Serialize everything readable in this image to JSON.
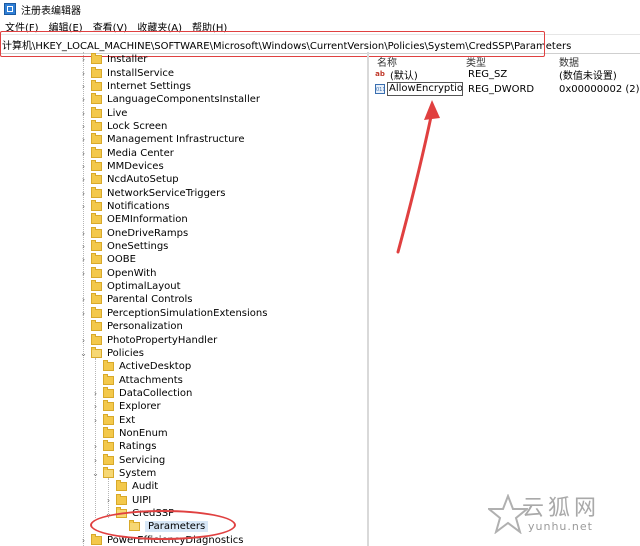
{
  "window": {
    "title": "注册表编辑器"
  },
  "menu": [
    "文件(F)",
    "编辑(E)",
    "查看(V)",
    "收藏夹(A)",
    "帮助(H)"
  ],
  "address": {
    "path": "计算机\\HKEY_LOCAL_MACHINE\\SOFTWARE\\Microsoft\\Windows\\CurrentVersion\\Policies\\System\\CredSSP\\Parameters"
  },
  "tree": [
    {
      "label": "Installer",
      "level": 0,
      "expander": "›",
      "open": false
    },
    {
      "label": "InstallService",
      "level": 0,
      "expander": "›",
      "open": false
    },
    {
      "label": "Internet Settings",
      "level": 0,
      "expander": "›",
      "open": false
    },
    {
      "label": "LanguageComponentsInstaller",
      "level": 0,
      "expander": "›",
      "open": false
    },
    {
      "label": "Live",
      "level": 0,
      "expander": "›",
      "open": false
    },
    {
      "label": "Lock Screen",
      "level": 0,
      "expander": "›",
      "open": false
    },
    {
      "label": "Management Infrastructure",
      "level": 0,
      "expander": "›",
      "open": false
    },
    {
      "label": "Media Center",
      "level": 0,
      "expander": "›",
      "open": false
    },
    {
      "label": "MMDevices",
      "level": 0,
      "expander": "›",
      "open": false
    },
    {
      "label": "NcdAutoSetup",
      "level": 0,
      "expander": "›",
      "open": false
    },
    {
      "label": "NetworkServiceTriggers",
      "level": 0,
      "expander": "›",
      "open": false
    },
    {
      "label": "Notifications",
      "level": 0,
      "expander": "›",
      "open": false
    },
    {
      "label": "OEMInformation",
      "level": 0,
      "expander": "",
      "open": false
    },
    {
      "label": "OneDriveRamps",
      "level": 0,
      "expander": "›",
      "open": false
    },
    {
      "label": "OneSettings",
      "level": 0,
      "expander": "›",
      "open": false
    },
    {
      "label": "OOBE",
      "level": 0,
      "expander": "›",
      "open": false
    },
    {
      "label": "OpenWith",
      "level": 0,
      "expander": "›",
      "open": false
    },
    {
      "label": "OptimalLayout",
      "level": 0,
      "expander": "",
      "open": false
    },
    {
      "label": "Parental Controls",
      "level": 0,
      "expander": "›",
      "open": false
    },
    {
      "label": "PerceptionSimulationExtensions",
      "level": 0,
      "expander": "›",
      "open": false
    },
    {
      "label": "Personalization",
      "level": 0,
      "expander": "",
      "open": false
    },
    {
      "label": "PhotoPropertyHandler",
      "level": 0,
      "expander": "›",
      "open": false
    },
    {
      "label": "Policies",
      "level": 0,
      "expander": "⌄",
      "open": true
    },
    {
      "label": "ActiveDesktop",
      "level": 1,
      "expander": "",
      "open": false
    },
    {
      "label": "Attachments",
      "level": 1,
      "expander": "",
      "open": false
    },
    {
      "label": "DataCollection",
      "level": 1,
      "expander": "›",
      "open": false
    },
    {
      "label": "Explorer",
      "level": 1,
      "expander": "›",
      "open": false
    },
    {
      "label": "Ext",
      "level": 1,
      "expander": "›",
      "open": false
    },
    {
      "label": "NonEnum",
      "level": 1,
      "expander": "",
      "open": false
    },
    {
      "label": "Ratings",
      "level": 1,
      "expander": "›",
      "open": false
    },
    {
      "label": "Servicing",
      "level": 1,
      "expander": "›",
      "open": false
    },
    {
      "label": "System",
      "level": 1,
      "expander": "⌄",
      "open": true
    },
    {
      "label": "Audit",
      "level": 2,
      "expander": "",
      "open": false
    },
    {
      "label": "UIPI",
      "level": 2,
      "expander": "›",
      "open": false
    },
    {
      "label": "CredSSP",
      "level": 2,
      "expander": "⌄",
      "open": true
    },
    {
      "label": "Parameters",
      "level": 3,
      "expander": "",
      "open": true,
      "selected": true
    },
    {
      "label": "PowerEfficiencyDiagnostics",
      "level": 0,
      "expander": "›",
      "open": false
    }
  ],
  "values_pane": {
    "headers": {
      "name": "名称",
      "type": "类型",
      "data": "数据"
    },
    "rows": [
      {
        "icon": "string-value-icon",
        "glyph": "ab",
        "name": "(默认)",
        "type": "REG_SZ",
        "data": "(数值未设置)",
        "editing": false
      },
      {
        "icon": "binary-value-icon",
        "glyph": "011",
        "name": "AllowEncryptio...",
        "type": "REG_DWORD",
        "data": "0x00000002 (2)",
        "editing": true
      }
    ]
  },
  "watermark": {
    "cn": "云狐网",
    "en": "yunhu.net"
  },
  "colors": {
    "annotation": "#e04040",
    "folder": "#f3c84b",
    "selection": "#d7e7f7"
  }
}
